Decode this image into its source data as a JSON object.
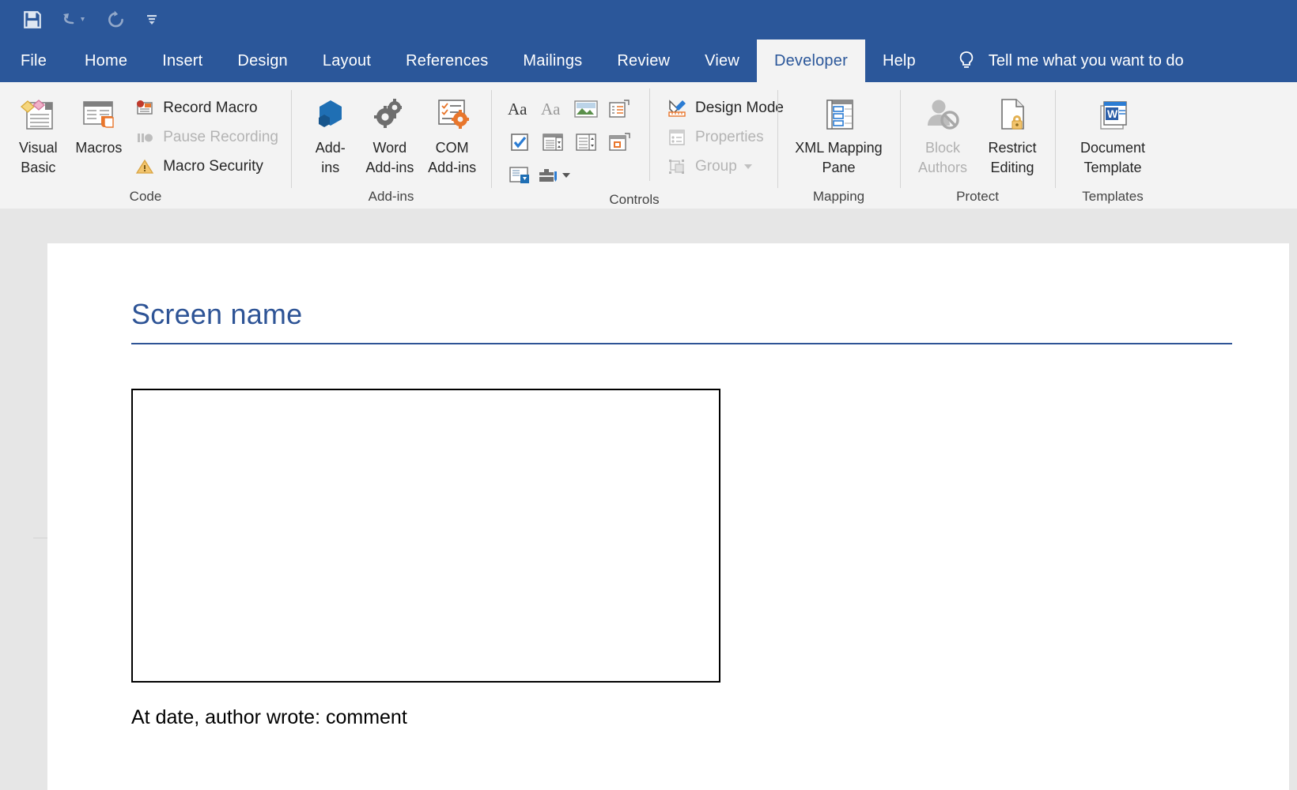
{
  "window": {
    "accent_color": "#2b579a",
    "ribbon_bg": "#f3f3f3"
  },
  "quick_access": {
    "items": [
      {
        "icon": "save-icon",
        "label": "Save"
      },
      {
        "icon": "undo-icon",
        "label": "Undo"
      },
      {
        "icon": "redo-icon",
        "label": "Redo"
      },
      {
        "icon": "customize-quick-access-toolbar-icon",
        "label": "Customize Quick Access Toolbar"
      }
    ]
  },
  "tabs": {
    "items": [
      {
        "label": "File",
        "active": false
      },
      {
        "label": "Home",
        "active": false
      },
      {
        "label": "Insert",
        "active": false
      },
      {
        "label": "Design",
        "active": false
      },
      {
        "label": "Layout",
        "active": false
      },
      {
        "label": "References",
        "active": false
      },
      {
        "label": "Mailings",
        "active": false
      },
      {
        "label": "Review",
        "active": false
      },
      {
        "label": "View",
        "active": false
      },
      {
        "label": "Developer",
        "active": true
      },
      {
        "label": "Help",
        "active": false
      }
    ],
    "tell_me": {
      "label": "Tell me what you want to do",
      "icon": "lightbulb-icon"
    }
  },
  "ribbon": {
    "groups": [
      {
        "name": "code",
        "label": "Code",
        "big_buttons": [
          {
            "label_line1": "Visual",
            "label_line2": "Basic",
            "icon": "visual-basic-icon",
            "disabled": false
          },
          {
            "label_line1": "Macros",
            "label_line2": "",
            "icon": "macros-icon",
            "disabled": false
          }
        ],
        "small_buttons": [
          {
            "label": "Record Macro",
            "icon": "record-macro-icon",
            "disabled": false
          },
          {
            "label": "Pause Recording",
            "icon": "pause-recording-icon",
            "disabled": true
          },
          {
            "label": "Macro Security",
            "icon": "macro-security-icon",
            "disabled": false
          }
        ]
      },
      {
        "name": "add-ins",
        "label": "Add-ins",
        "big_buttons": [
          {
            "label_line1": "Add-",
            "label_line2": "ins",
            "icon": "add-ins-icon",
            "disabled": false
          },
          {
            "label_line1": "Word",
            "label_line2": "Add-ins",
            "icon": "word-add-ins-icon",
            "disabled": false
          },
          {
            "label_line1": "COM",
            "label_line2": "Add-ins",
            "icon": "com-add-ins-icon",
            "disabled": false
          }
        ],
        "small_buttons": []
      },
      {
        "name": "controls",
        "label": "Controls",
        "grid_icons": [
          "rich-text-content-control-icon",
          "plain-text-content-control-icon",
          "picture-content-control-icon",
          "building-block-gallery-content-control-icon",
          "check-box-content-control-icon",
          "combo-box-content-control-icon",
          "drop-down-list-content-control-icon",
          "date-picker-content-control-icon",
          "repeating-section-content-control-icon",
          "legacy-tools-icon"
        ],
        "small_buttons": [
          {
            "label": "Design Mode",
            "icon": "design-mode-icon",
            "disabled": false
          },
          {
            "label": "Properties",
            "icon": "properties-icon",
            "disabled": true
          },
          {
            "label": "Group",
            "icon": "group-icon",
            "disabled": true
          }
        ]
      },
      {
        "name": "mapping",
        "label": "Mapping",
        "big_buttons": [
          {
            "label_line1": "XML Mapping",
            "label_line2": "Pane",
            "icon": "xml-mapping-pane-icon",
            "disabled": false
          }
        ],
        "small_buttons": []
      },
      {
        "name": "protect",
        "label": "Protect",
        "big_buttons": [
          {
            "label_line1": "Block",
            "label_line2": "Authors",
            "icon": "block-authors-icon",
            "disabled": true
          },
          {
            "label_line1": "Restrict",
            "label_line2": "Editing",
            "icon": "restrict-editing-icon",
            "disabled": false
          }
        ],
        "small_buttons": []
      },
      {
        "name": "templates",
        "label": "Templates",
        "big_buttons": [
          {
            "label_line1": "Document",
            "label_line2": "Template",
            "icon": "document-template-icon",
            "disabled": false
          }
        ],
        "small_buttons": []
      }
    ]
  },
  "document": {
    "heading": "Screen name",
    "heading_color": "#2e5496",
    "caption": "At date, author wrote: comment",
    "content_box": {
      "empty": true
    }
  }
}
